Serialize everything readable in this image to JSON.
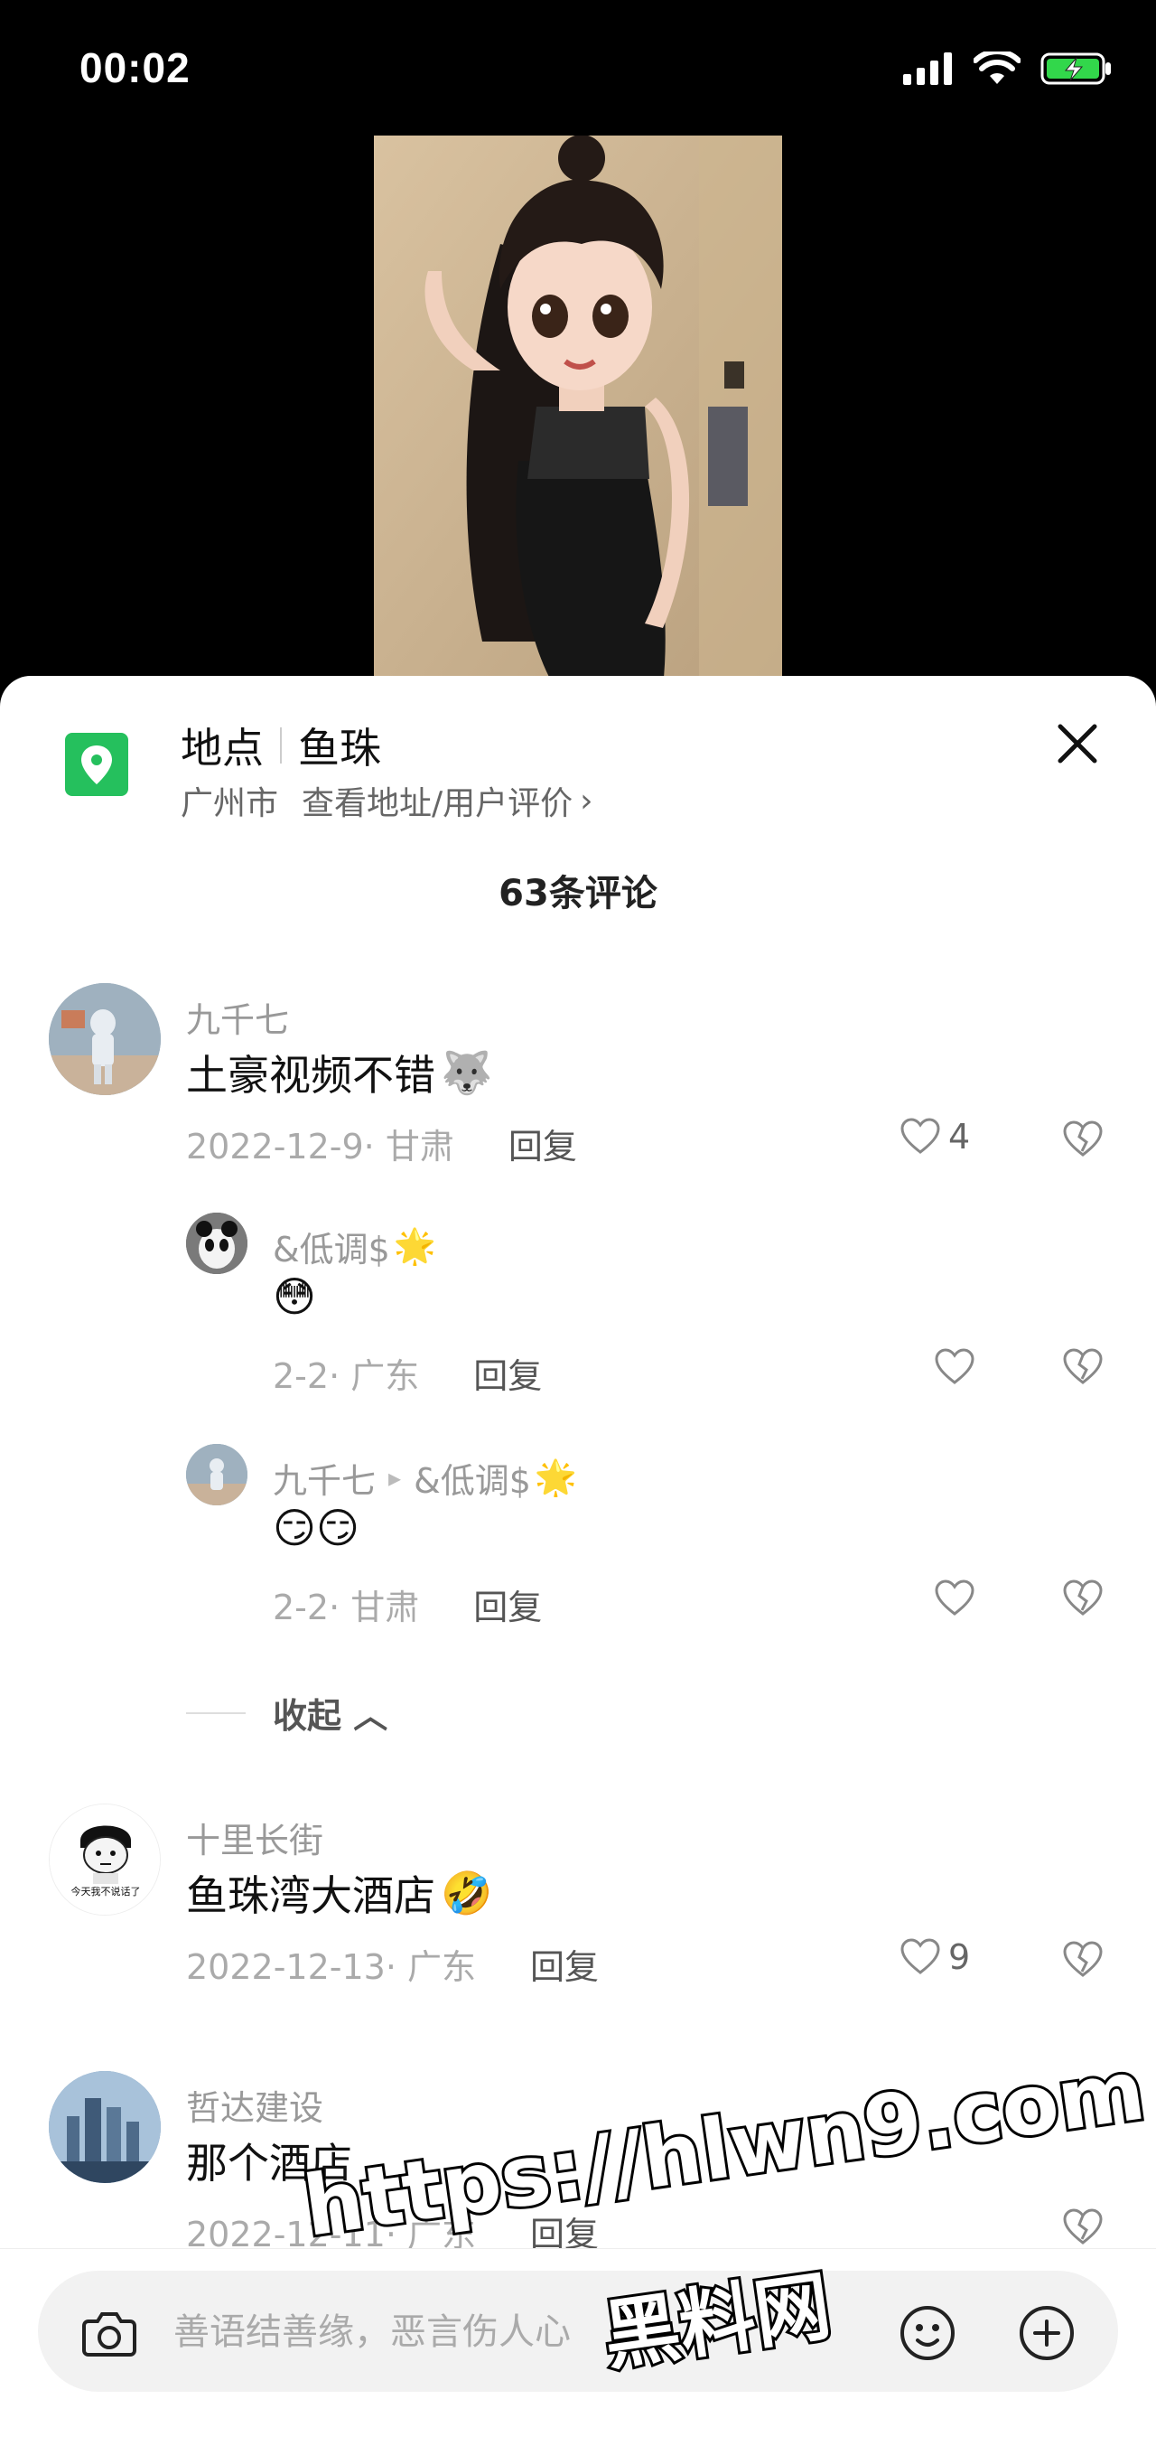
{
  "status_bar": {
    "time": "00:02"
  },
  "location": {
    "label": "地点",
    "name": "鱼珠",
    "city": "广州市",
    "link": "查看地址/用户评价",
    "chevron": "›"
  },
  "comments_header": {
    "count_label": "63条评论"
  },
  "comments": [
    {
      "user": "九千七",
      "text": "土豪视频不错",
      "emoji": "🐺",
      "date_loc": "2022-12-9· 甘肃",
      "reply_label": "回复",
      "likes": "4",
      "avatar_icon": "astronaut-avatar",
      "replies": [
        {
          "user": "&低调$",
          "user_emoji": "🌟",
          "text": "😳",
          "date_loc": "2-2· 广东",
          "reply_label": "回复",
          "avatar_icon": "panda-avatar"
        },
        {
          "user": "九千七",
          "reply_arrow": "▸",
          "reply_to": "&低调$",
          "reply_to_emoji": "🌟",
          "text": "😏😏",
          "date_loc": "2-2· 甘肃",
          "reply_label": "回复",
          "avatar_icon": "astronaut-avatar"
        }
      ],
      "collapse_label": "收起 ︿"
    },
    {
      "user": "十里长街",
      "text": "鱼珠湾大酒店",
      "emoji": "🤣",
      "date_loc": "2022-12-13· 广东",
      "reply_label": "回复",
      "likes": "9",
      "avatar_icon": "meme-avatar",
      "avatar_caption": "今天我不说话了"
    },
    {
      "user": "哲达建设",
      "text": "那个酒店",
      "date_loc": "2022-12-11· 广东",
      "reply_label": "回复",
      "avatar_icon": "building-avatar"
    }
  ],
  "input_bar": {
    "placeholder": "善语结善缘，恶言伤人心"
  },
  "watermark": {
    "url": "https://hlwn9.com",
    "site": "黑料网"
  }
}
